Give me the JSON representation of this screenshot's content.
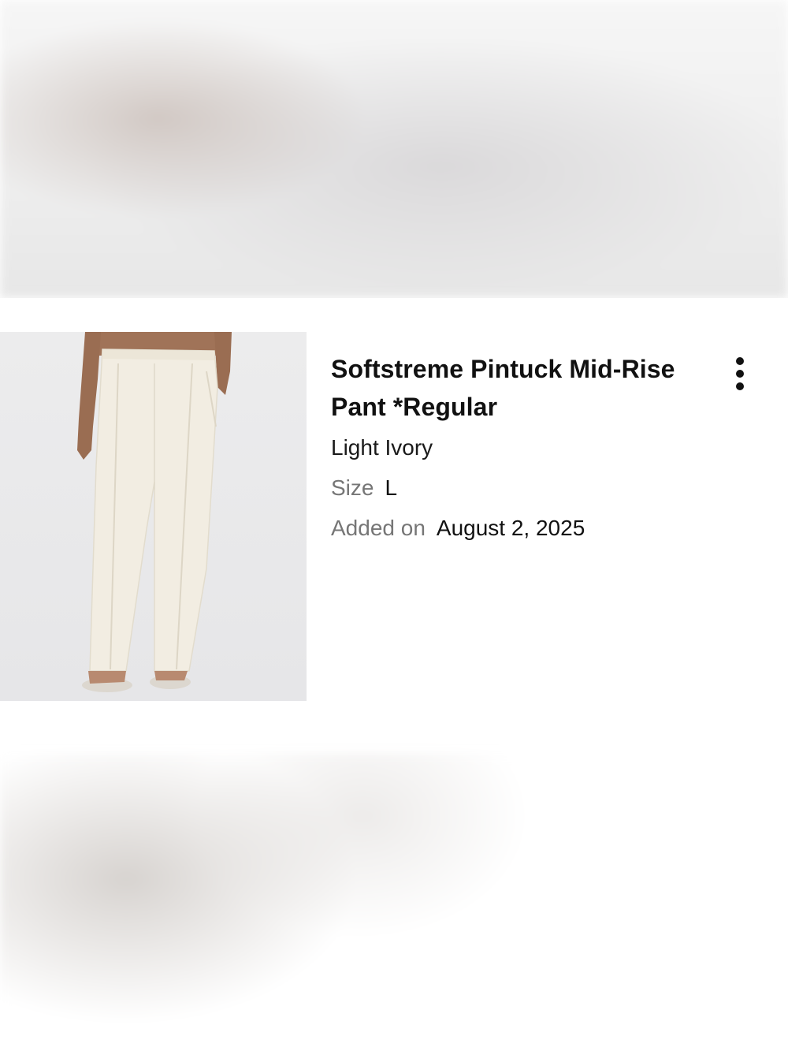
{
  "item": {
    "title": "Softstreme Pintuck Mid-Rise Pant *Regular",
    "color": "Light Ivory",
    "size_label": "Size",
    "size_value": "L",
    "added_label": "Added on",
    "added_value": "August 2, 2025",
    "image_icon": "product-photo",
    "menu_icon": "more-vertical-icon"
  },
  "colors": {
    "text_primary": "#111111",
    "text_secondary": "#767676",
    "image_background": "#e8e8ea",
    "pant": "#f1ece0"
  }
}
